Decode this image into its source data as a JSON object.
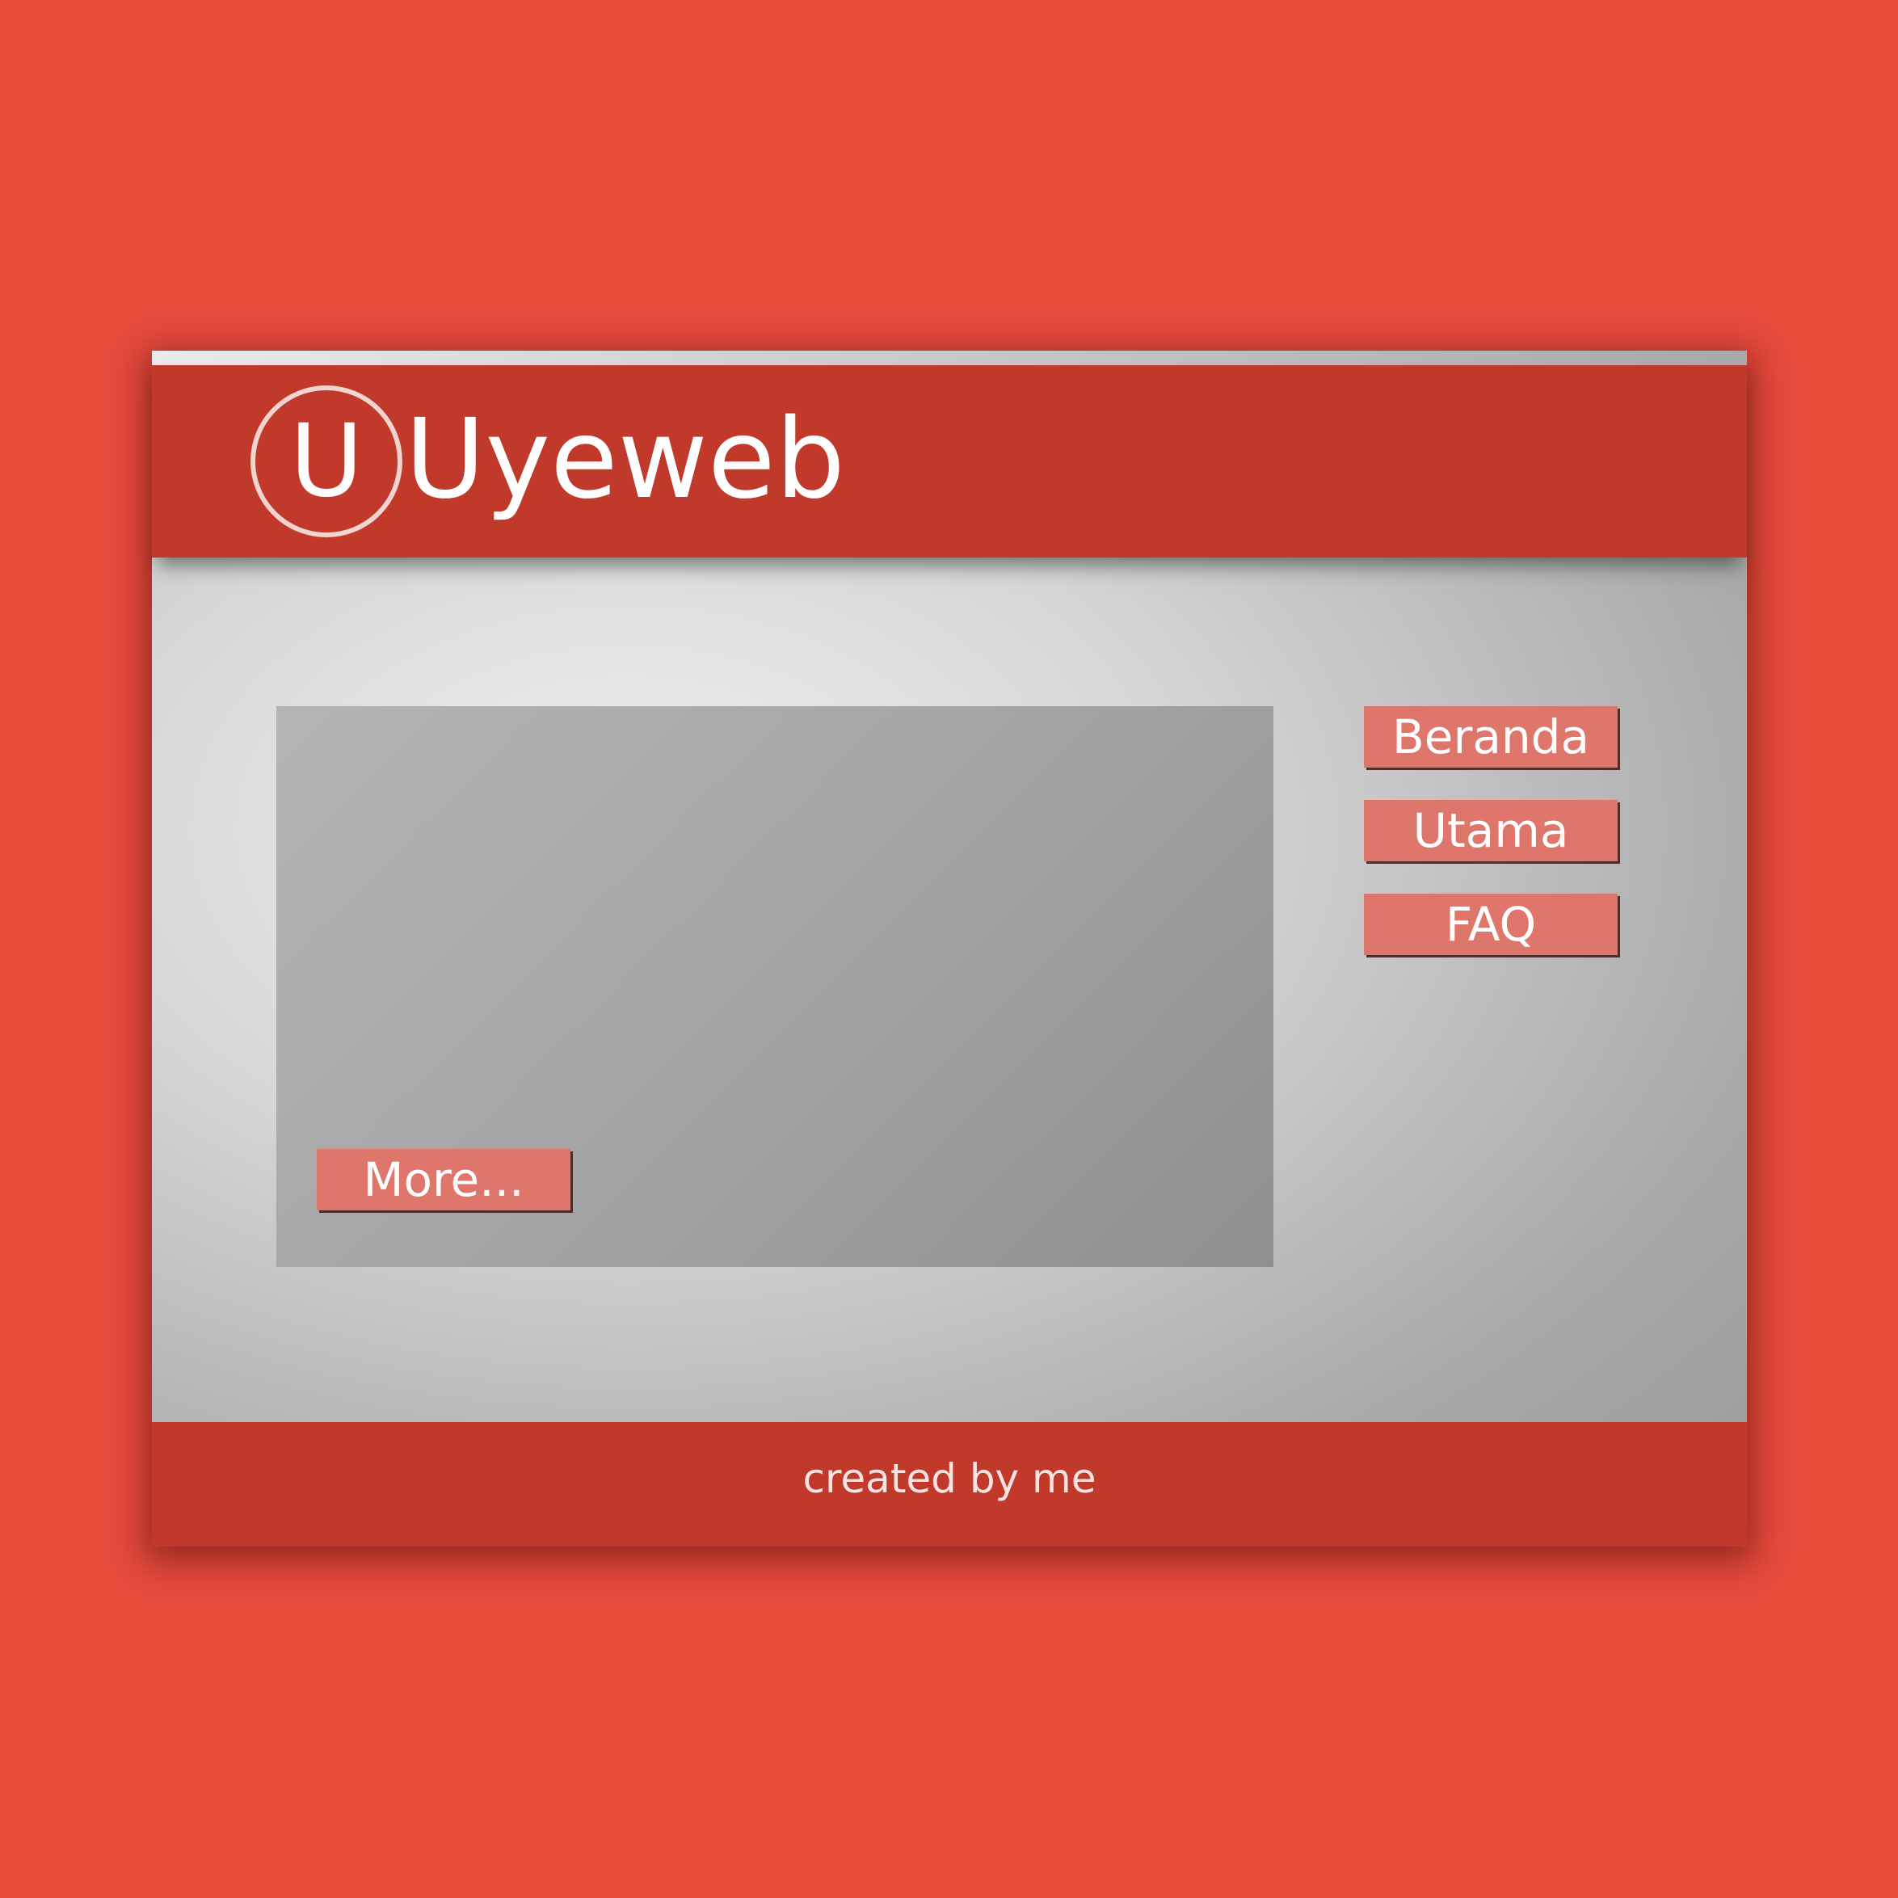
{
  "header": {
    "logo_letter": "U",
    "brand_name": "Uyeweb"
  },
  "main": {
    "more_label": "More..."
  },
  "nav": {
    "items": [
      {
        "label": "Beranda"
      },
      {
        "label": "Utama"
      },
      {
        "label": "FAQ"
      }
    ]
  },
  "footer": {
    "text": "created by me"
  },
  "colors": {
    "background": "#e74c3d",
    "header_bar": "#c0392b",
    "button": "#df766b",
    "text": "#ffffff"
  }
}
